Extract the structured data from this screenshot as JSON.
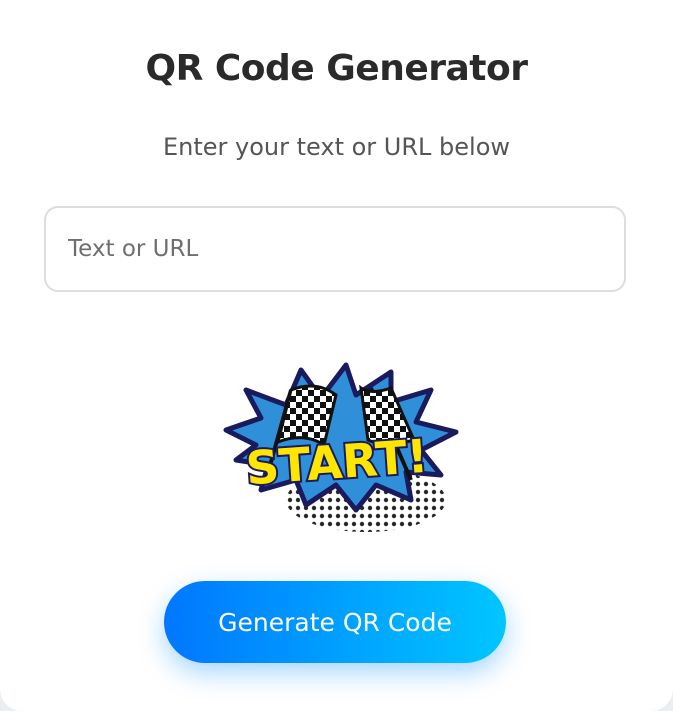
{
  "header": {
    "title": "QR Code Generator",
    "subtitle": "Enter your text or URL below"
  },
  "input": {
    "placeholder": "Text or URL",
    "value": ""
  },
  "image": {
    "label": "START!"
  },
  "actions": {
    "generate_label": "Generate QR Code"
  },
  "colors": {
    "title": "#2a2a2a",
    "subtitle": "#555555",
    "button_gradient_start": "#0077ff",
    "button_gradient_end": "#00c6ff",
    "input_border": "#dddddd",
    "burst_blue": "#2f8fd8",
    "burst_outline": "#1a1a5e",
    "start_text": "#ffe600"
  }
}
